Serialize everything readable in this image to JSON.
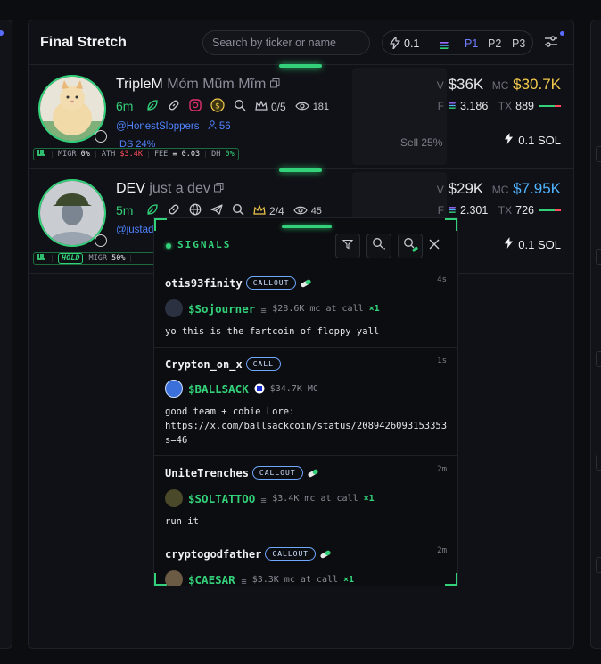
{
  "panel": {
    "title": "Final Stretch",
    "search_placeholder": "Search by ticker or name",
    "quick_buy_amount": "0.1",
    "presets": [
      "P1",
      "P2",
      "P3"
    ],
    "active_preset": "P1"
  },
  "tokens": [
    {
      "ticker": "TripleM",
      "name": "Móm Mũm Mĩm",
      "age": "6m",
      "holders_ratio": "0/5",
      "views": "181",
      "handle": "@HonestSloppers",
      "followers": "56",
      "hidden_partial": "DS  24%",
      "migr_label": "MIGR",
      "migr": "0%",
      "ath_label": "ATH",
      "ath": "$3.4K",
      "fee_label": "FEE",
      "fee": "0.03",
      "dh_label": "DH",
      "dh": "0%",
      "sell_label": "Sell 25%",
      "v_label": "V",
      "volume": "$36K",
      "mc_label": "MC",
      "market_cap": "$30.7K",
      "f_label": "F",
      "fees_paid": "3.186",
      "tx_label": "TX",
      "tx": "889",
      "buy_amount": "0.1 SOL",
      "mc_color": "#f2c94c"
    },
    {
      "ticker": "DEV",
      "name": "just a dev",
      "age": "5m",
      "holders_ratio": "2/4",
      "views": "45",
      "handle": "@justadev",
      "hold_label": "HOLD",
      "migr_label": "MIGR",
      "migr": "50%",
      "v_label": "V",
      "volume": "$29K",
      "mc_label": "MC",
      "market_cap": "$7.95K",
      "f_label": "F",
      "fees_paid": "2.301",
      "tx_label": "TX",
      "tx": "726",
      "buy_amount": "0.1 SOL",
      "mc_color": "#4fb3ff"
    }
  ],
  "signals": {
    "title": "SIGNALS",
    "items": [
      {
        "user": "otis93finity",
        "badge": "CALLOUT",
        "time": "4s",
        "ticker": "$Sojourner",
        "mc": "$28.6K mc at call",
        "mult": "×1",
        "message": "yo this is the fartcoin of floppy yall"
      },
      {
        "user": "Crypton_on_x",
        "badge": "CALL",
        "time": "1s",
        "ticker": "$BALLSACK",
        "mc": "$34.7K MC",
        "mult": "",
        "message": "good team + cobie Lore:\nhttps://x.com/ballsackcoin/status/2089426093153353\ns=46"
      },
      {
        "user": "UniteTrenches",
        "badge": "CALLOUT",
        "time": "2m",
        "ticker": "$SOLTATTOO",
        "mc": "$3.4K mc at call",
        "mult": "×1",
        "message": "run it"
      },
      {
        "user": "cryptogodfather",
        "badge": "CALLOUT",
        "time": "2m",
        "ticker": "$CAESAR",
        "mc": "$3.3K mc at call",
        "mult": "×1",
        "message": ""
      }
    ]
  },
  "colors": {
    "accent_green": "#33d17a",
    "blue": "#4f83ff",
    "red": "#ff4d5e"
  }
}
